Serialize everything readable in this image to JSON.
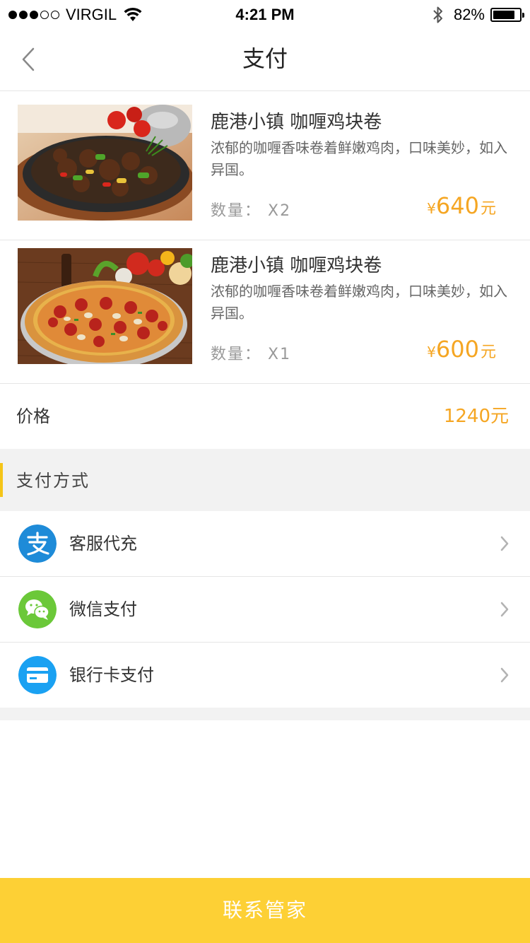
{
  "status_bar": {
    "carrier": "VIRGIL",
    "time": "4:21 PM",
    "battery": "82%",
    "battery_level": 0.82,
    "signal_bars_filled": 3,
    "signal_bars_total": 5
  },
  "nav": {
    "title": "支付",
    "back_icon": "chevron-left-icon"
  },
  "items": [
    {
      "name": "鹿港小镇 咖喱鸡块卷",
      "description": "浓郁的咖喱香味卷着鲜嫩鸡肉，口味美妙，如入异国。",
      "quantity": "数量：  X2",
      "price_symbol": "¥",
      "price_value": "640",
      "price_unit": "元",
      "image": "sizzling-beef-dish-photo"
    },
    {
      "name": "鹿港小镇 咖喱鸡块卷",
      "description": "浓郁的咖喱香味卷着鲜嫩鸡肉，口味美妙，如入异国。",
      "quantity": "数量：  X1",
      "price_symbol": "¥",
      "price_value": "600",
      "price_unit": "元",
      "image": "pepperoni-pizza-photo"
    }
  ],
  "total": {
    "label": "价格",
    "value": "1240元"
  },
  "payment_section": {
    "title": "支付方式",
    "methods": [
      {
        "label": "客服代充",
        "icon": "alipay-icon",
        "color": "#1e8bd8"
      },
      {
        "label": "微信支付",
        "icon": "wechat-icon",
        "color": "#6bc839"
      },
      {
        "label": "银行卡支付",
        "icon": "bank-card-icon",
        "color": "#1aa1f2"
      }
    ]
  },
  "bottom_button": {
    "label": "联系管家"
  },
  "colors": {
    "accent": "#f5a623",
    "primary_button": "#fdd035",
    "section_accent": "#f5c518"
  }
}
